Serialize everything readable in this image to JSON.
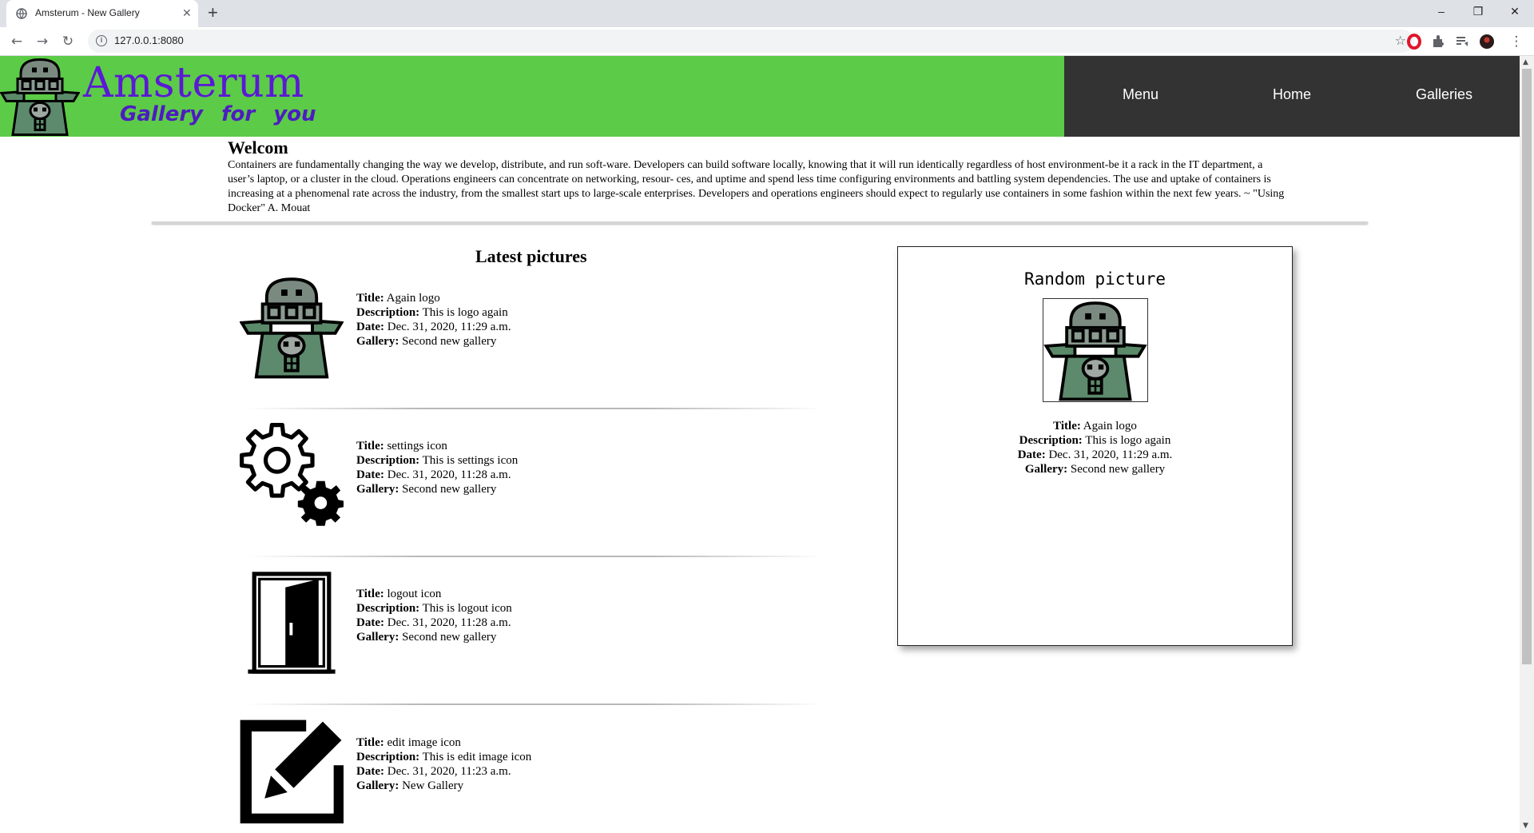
{
  "browser": {
    "tab_title": "Amsterum - New Gallery",
    "tab_close": "✕",
    "new_tab": "+",
    "url": "127.0.0.1:8080",
    "back": "←",
    "forward": "→",
    "reload": "↻",
    "minimize": "–",
    "restore": "❐",
    "close": "✕",
    "menu_dots": "⋮",
    "star": "☆"
  },
  "header": {
    "brand": "Amsterum",
    "tagline": "Gallery for you",
    "nav": [
      {
        "label": "Menu"
      },
      {
        "label": "Home"
      },
      {
        "label": "Galleries"
      }
    ],
    "colors": {
      "green": "#5ccb47",
      "dark": "#333333",
      "brand": "#5b18d6"
    }
  },
  "welcome": {
    "title": "Welcom",
    "text": "Containers are fundamentally changing the way we develop, distribute, and run soft-ware. Developers can build software locally, knowing that it will run identically regardless of host environment-be it a rack in the IT department, a user’s laptop, or a cluster in the cloud. Operations engineers can concentrate on networking, resour- ces, and uptime and spend less time configuring environments and battling system dependencies. The use and uptake of containers is increasing at a phenomenal rate across the industry, from the smallest start ups to large-scale enterprises. Developers and operations engineers should expect to regularly use containers in some fashion within the next few years. ~ \"Using Docker\" A. Mouat"
  },
  "labels": {
    "title": "Title:",
    "description": "Description:",
    "date": "Date:",
    "gallery": "Gallery:"
  },
  "latest": {
    "heading": "Latest pictures",
    "items": [
      {
        "icon": "robot-logo-icon",
        "title": "Again logo",
        "description": "This is logo again",
        "date": "Dec. 31, 2020, 11:29 a.m.",
        "gallery": "Second new gallery"
      },
      {
        "icon": "settings-gears-icon",
        "title": "settings icon",
        "description": "This is settings icon",
        "date": "Dec. 31, 2020, 11:28 a.m.",
        "gallery": "Second new gallery"
      },
      {
        "icon": "door-icon",
        "title": "logout icon",
        "description": "This is logout icon",
        "date": "Dec. 31, 2020, 11:28 a.m.",
        "gallery": "Second new gallery"
      },
      {
        "icon": "edit-image-icon",
        "title": "edit image icon",
        "description": "This is edit image icon",
        "date": "Dec. 31, 2020, 11:23 a.m.",
        "gallery": "New Gallery"
      }
    ]
  },
  "random": {
    "heading": "Random picture",
    "title": "Again logo",
    "description": "This is logo again",
    "date": "Dec. 31, 2020, 11:29 a.m.",
    "gallery": "Second new gallery"
  }
}
